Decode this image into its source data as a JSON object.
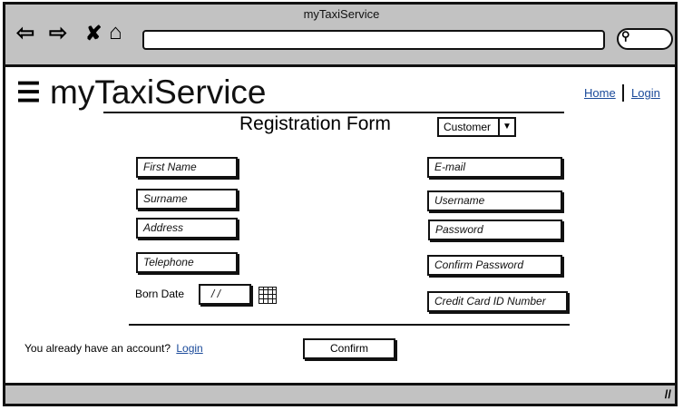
{
  "browser": {
    "title": "myTaxiService"
  },
  "header": {
    "logo": "myTaxiService",
    "nav": {
      "home": "Home",
      "login": "Login"
    }
  },
  "form": {
    "title": "Registration Form",
    "user_type": "Customer",
    "left_fields": [
      "First Name",
      "Surname",
      "Address",
      "Telephone"
    ],
    "right_fields": [
      "E-mail",
      "Username",
      "Password",
      "Confirm Password",
      "Credit Card ID Number"
    ],
    "born_date_label": "Born Date",
    "born_date_value": "/ /",
    "account_prompt": "You already have an account?",
    "login_link": "Login",
    "confirm": "Confirm"
  }
}
